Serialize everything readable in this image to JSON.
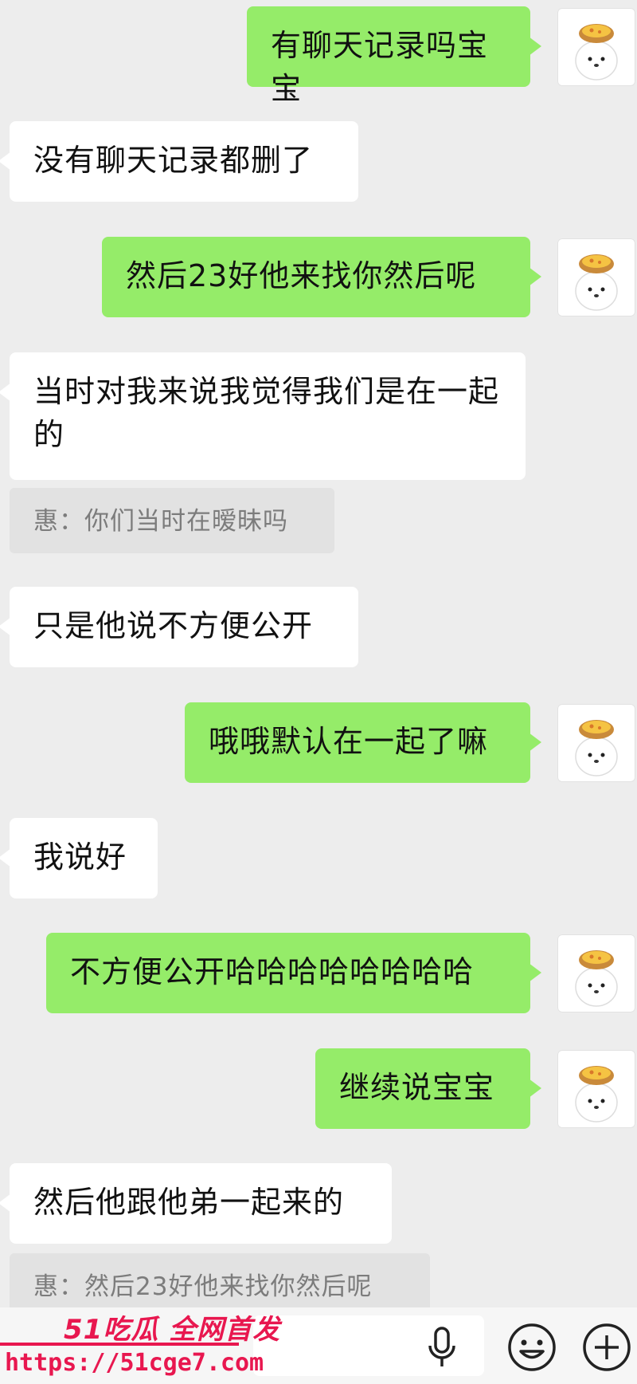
{
  "messages": [
    {
      "side": "out",
      "text": "有聊天记录吗宝宝"
    },
    {
      "side": "in",
      "text": "没有聊天记录都删了"
    },
    {
      "side": "out",
      "text": "然后23好他来找你然后呢"
    },
    {
      "side": "in",
      "text": "当时对我来说我觉得我们是在一起的"
    },
    {
      "side": "quote",
      "text": "惠：你们当时在暧昧吗"
    },
    {
      "side": "in",
      "text": "只是他说不方便公开"
    },
    {
      "side": "out",
      "text": "哦哦默认在一起了嘛"
    },
    {
      "side": "in",
      "text": "我说好"
    },
    {
      "side": "out",
      "text": "不方便公开哈哈哈哈哈哈哈哈"
    },
    {
      "side": "out",
      "text": "继续说宝宝"
    },
    {
      "side": "in",
      "text": "然后他跟他弟一起来的"
    },
    {
      "side": "quote",
      "text": "惠：然后23好他来找你然后呢"
    }
  ],
  "avatar": {
    "icon": "puppy-with-egg-tart-icon"
  },
  "input_bar": {
    "icons": [
      "microphone-icon",
      "emoji-icon",
      "plus-icon"
    ]
  },
  "watermark": {
    "brand": "51吃瓜 全网首发",
    "url": "https://51cge7.com"
  },
  "colors": {
    "outgoing_bubble": "#95ec69",
    "incoming_bubble": "#ffffff",
    "quote_bg": "#e2e2e2",
    "background": "#ededed",
    "watermark": "#e8174f"
  }
}
